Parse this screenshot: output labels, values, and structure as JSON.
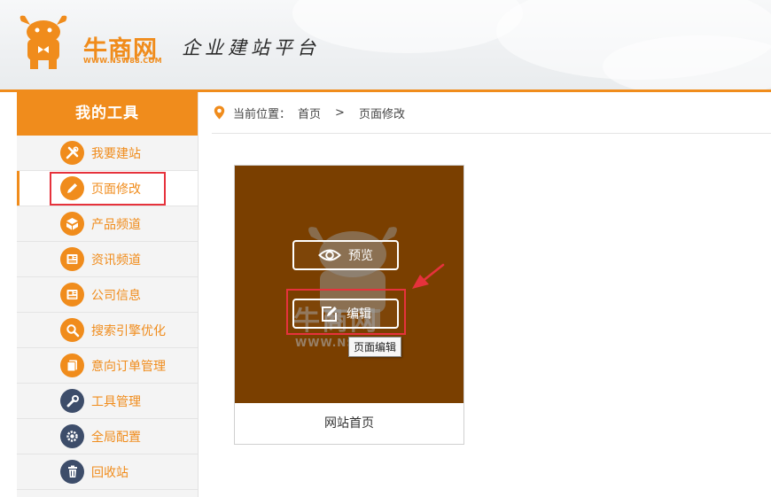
{
  "header": {
    "logo_name": "牛商网",
    "logo_url": "WWW.NSW88.COM",
    "slogan": "企业建站平台",
    "brand_color": "#f08c1c"
  },
  "sidebar": {
    "title": "我的工具",
    "items": [
      {
        "label": "我要建站",
        "icon": "tools-icon",
        "active": false
      },
      {
        "label": "页面修改",
        "icon": "pencil-icon",
        "active": true
      },
      {
        "label": "产品频道",
        "icon": "box-icon",
        "active": false
      },
      {
        "label": "资讯频道",
        "icon": "news-icon",
        "active": false
      },
      {
        "label": "公司信息",
        "icon": "company-icon",
        "active": false
      },
      {
        "label": "搜索引擎优化",
        "icon": "search-icon",
        "active": false
      },
      {
        "label": "意向订单管理",
        "icon": "order-icon",
        "active": false
      },
      {
        "label": "工具管理",
        "icon": "wrench-icon",
        "active": false
      },
      {
        "label": "全局配置",
        "icon": "gear-icon",
        "active": false
      },
      {
        "label": "回收站",
        "icon": "trash-icon",
        "active": false
      }
    ]
  },
  "breadcrumb": {
    "prefix": "当前位置：",
    "home": "首页",
    "separator": ">",
    "current": "页面修改"
  },
  "card": {
    "caption": "网站首页",
    "preview_label": "预览",
    "edit_label": "编辑",
    "tooltip": "页面编辑",
    "watermark_text": "牛商网",
    "watermark_url": "WWW.NSW"
  },
  "colors": {
    "accent": "#f08c1c",
    "thumbnail_bg": "#7a3f00",
    "highlight_red": "#e6323c",
    "dark_icon": "#3d4d6a"
  }
}
